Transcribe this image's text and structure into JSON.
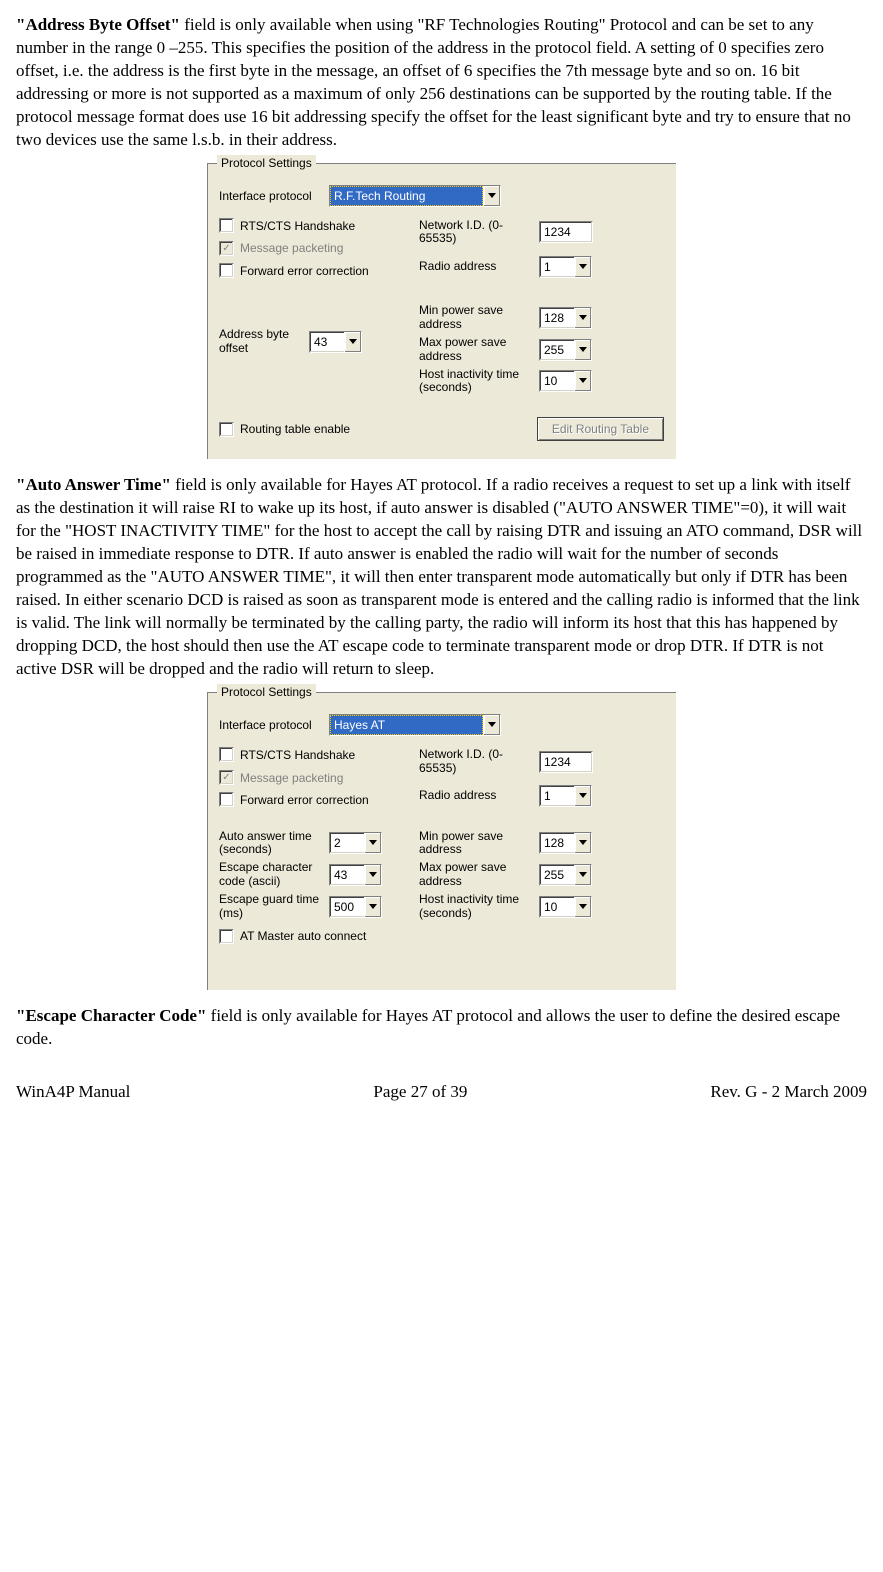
{
  "para1": {
    "heading": "\"Address Byte  Offset\"",
    "text": "  field is only available when using \"RF Technologies Routing\" Protocol and can be set to any number in the range 0 –255.  This specifies the position of the address in the protocol field. A setting of 0 specifies zero offset, i.e. the address is the first byte in the message, an offset of 6 specifies the 7th message byte and so on.  16 bit addressing or more is not supported as a maximum of only 256 destinations can be supported by the routing table.  If the protocol message format does use 16 bit addressing specify the offset for the least significant byte and try to ensure that no two devices use the same l.s.b. in their address."
  },
  "panel1": {
    "legend": "Protocol Settings",
    "interface_protocol_label": "Interface protocol",
    "interface_protocol_value": "R.F.Tech Routing",
    "rts_label": "RTS/CTS Handshake",
    "msgpkt_label": "Message packeting",
    "msgpkt_checked": "✓",
    "fec_label": "Forward error correction",
    "addr_offset_label": "Address byte offset",
    "addr_offset_value": "43",
    "routing_label": "Routing table enable",
    "edit_routing_btn": "Edit Routing Table",
    "netid_label": "Network I.D. (0-65535)",
    "netid_value": "1234",
    "radioaddr_label": "Radio address",
    "radioaddr_value": "1",
    "minpow_label": "Min power save address",
    "minpow_value": "128",
    "maxpow_label": "Max power save address",
    "maxpow_value": "255",
    "hostinact_label": "Host inactivity time (seconds)",
    "hostinact_value": "10"
  },
  "para2": {
    "heading": "\"Auto Answer Time\"",
    "text": " field is only available for Hayes AT protocol.  If a radio receives a request to set up a link with itself as the destination it will raise RI to wake up its host, if auto answer is disabled (\"AUTO ANSWER TIME\"=0), it will wait for the \"HOST INACTIVITY TIME\" for the host to accept the call by raising DTR and issuing an ATO command, DSR will be raised in immediate response to DTR. If auto answer is enabled the radio will wait for the number of seconds programmed as the \"AUTO ANSWER TIME\", it will then enter transparent mode automatically but only if DTR has been raised. In either scenario DCD is raised as soon as transparent mode is entered and the calling radio is informed that the link is valid.  The link will normally be terminated by the calling party, the radio will inform its host that this has happened by dropping DCD, the host should then use the AT escape code to terminate transparent mode or drop DTR. If DTR is not active DSR will be dropped and the radio will return to sleep."
  },
  "panel2": {
    "legend": "Protocol Settings",
    "interface_protocol_label": "Interface protocol",
    "interface_protocol_value": "Hayes AT",
    "rts_label": "RTS/CTS Handshake",
    "msgpkt_label": "Message packeting",
    "msgpkt_checked": "✓",
    "fec_label": "Forward error correction",
    "autoans_label": "Auto answer time (seconds)",
    "autoans_value": "2",
    "escchar_label": "Escape character code (ascii)",
    "escchar_value": "43",
    "escguard_label": "Escape guard time (ms)",
    "escguard_value": "500",
    "atmaster_label": "AT Master auto connect",
    "netid_label": "Network I.D. (0-65535)",
    "netid_value": "1234",
    "radioaddr_label": "Radio address",
    "radioaddr_value": "1",
    "minpow_label": "Min power save address",
    "minpow_value": "128",
    "maxpow_label": "Max power save address",
    "maxpow_value": "255",
    "hostinact_label": "Host inactivity time (seconds)",
    "hostinact_value": "10"
  },
  "para3": {
    "heading": "\"Escape Character Code\"",
    "text": " field is only available for Hayes AT protocol and allows the user to define the desired escape code."
  },
  "footer": {
    "left": "WinA4P Manual",
    "center": "Page 27 of 39",
    "right": "Rev. G -  2 March 2009"
  }
}
